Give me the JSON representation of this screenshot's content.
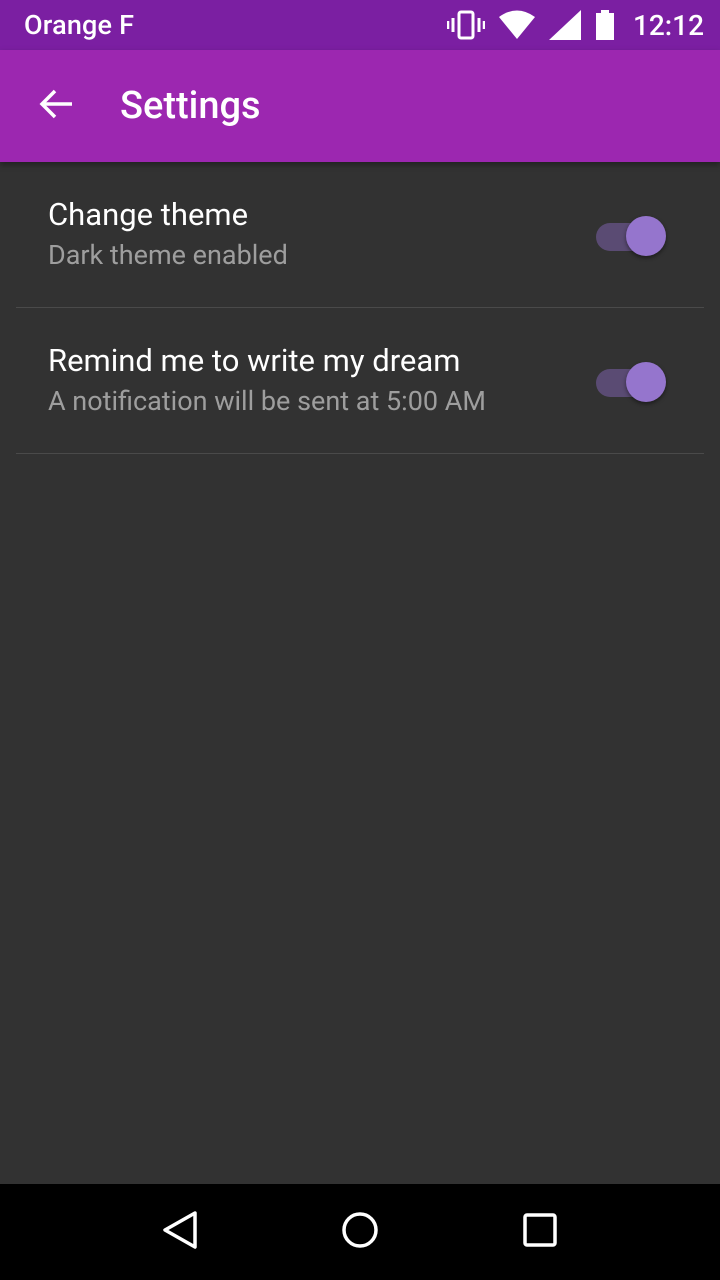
{
  "status_bar": {
    "carrier": "Orange F",
    "time": "12:12",
    "icons": [
      "vibrate-icon",
      "wifi-icon",
      "cellular-signal-icon",
      "battery-icon"
    ]
  },
  "app_bar": {
    "title": "Settings",
    "back_icon": "arrow-back-icon"
  },
  "settings": [
    {
      "title": "Change theme",
      "summary": "Dark theme enabled",
      "enabled": true
    },
    {
      "title": "Remind me to write my dream",
      "summary": "A notification will be sent at 5:00 AM",
      "enabled": true
    }
  ],
  "nav_bar": {
    "icons": [
      "back-triangle-icon",
      "home-circle-icon",
      "recents-square-icon"
    ]
  },
  "colors": {
    "status_bar": "#7B1FA2",
    "app_bar": "#9C27B0",
    "background": "#323232",
    "switch_thumb": "#9575CD",
    "switch_track": "#5A4B73"
  }
}
